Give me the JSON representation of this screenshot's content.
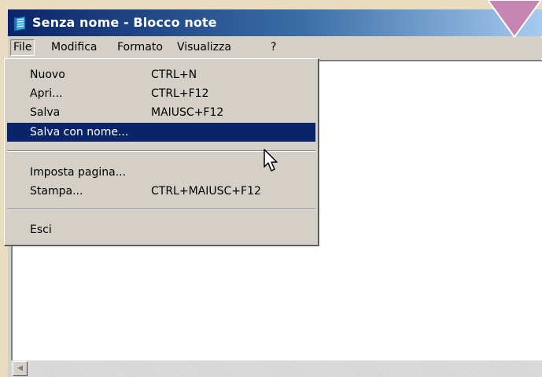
{
  "window": {
    "title": "Senza nome - Blocco note"
  },
  "menubar": {
    "items": [
      {
        "label": "File"
      },
      {
        "label": "Modifica"
      },
      {
        "label": "Formato"
      },
      {
        "label": "Visualizza"
      },
      {
        "label": "?"
      }
    ],
    "open_menu": "File"
  },
  "file_menu": {
    "items": [
      {
        "label": "Nuovo",
        "shortcut": "CTRL+N"
      },
      {
        "label": "Apri...",
        "shortcut": "CTRL+F12"
      },
      {
        "label": "Salva",
        "shortcut": "MAIUSC+F12"
      },
      {
        "label": "Salva con nome...",
        "shortcut": "",
        "selected": true
      },
      {
        "label": "Imposta pagina...",
        "shortcut": ""
      },
      {
        "label": "Stampa...",
        "shortcut": "CTRL+MAIUSC+F12"
      },
      {
        "label": "Esci",
        "shortcut": ""
      }
    ]
  },
  "icons": {
    "app": "notepad-icon",
    "scroll_left": "scroll-left-arrow-icon",
    "cursor": "mouse-pointer-icon",
    "marker": "down-triangle-marker"
  },
  "colors": {
    "selection": "#0a246a",
    "title_gradient_start": "#0a246a",
    "title_gradient_end": "#a6caf0",
    "marker": "#c586b4",
    "background": "#e9dcc0",
    "chrome": "#d4d0c8"
  }
}
